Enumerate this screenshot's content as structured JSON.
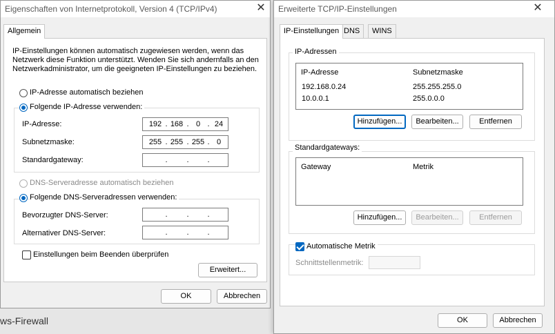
{
  "dialog1": {
    "title": "Eigenschaften von Internetprotokoll, Version 4 (TCP/IPv4)",
    "tab": "Allgemein",
    "intro_line1": "IP-Einstellungen können automatisch zugewiesen werden, wenn das",
    "intro_line2": "Netzwerk diese Funktion unterstützt. Wenden Sie sich andernfalls an den",
    "intro_line3": "Netzwerkadministrator, um die geeigneten IP-Einstellungen zu beziehen.",
    "radio_auto_ip": "IP-Adresse automatisch beziehen",
    "radio_manual_ip": "Folgende IP-Adresse verwenden:",
    "label_ip": "IP-Adresse:",
    "label_mask": "Subnetzmaske:",
    "label_gateway": "Standardgateway:",
    "ip_octets": [
      "192",
      "168",
      "0",
      "24"
    ],
    "mask_octets": [
      "255",
      "255",
      "255",
      "0"
    ],
    "radio_auto_dns": "DNS-Serveradresse automatisch beziehen",
    "radio_manual_dns": "Folgende DNS-Serveradressen verwenden:",
    "label_dns1": "Bevorzugter DNS-Server:",
    "label_dns2": "Alternativer DNS-Server:",
    "checkbox_validate": "Einstellungen beim Beenden überprüfen",
    "btn_advanced": "Erweitert...",
    "btn_ok": "OK",
    "btn_cancel": "Abbrechen"
  },
  "background_text": "ws-Firewall",
  "dialog2": {
    "title": "Erweiterte TCP/IP-Einstellungen",
    "tabs": [
      "IP-Einstellungen",
      "DNS",
      "WINS"
    ],
    "group_ip": "IP-Adressen",
    "col_ip": "IP-Adresse",
    "col_mask": "Subnetzmaske",
    "ip_rows": [
      {
        "ip": "192.168.0.24",
        "mask": "255.255.255.0"
      },
      {
        "ip": "10.0.0.1",
        "mask": "255.0.0.0"
      }
    ],
    "btn_add": "Hinzufügen...",
    "btn_edit": "Bearbeiten...",
    "btn_remove": "Entfernen",
    "group_gateways": "Standardgateways:",
    "col_gateway": "Gateway",
    "col_metric": "Metrik",
    "checkbox_auto_metric": "Automatische Metrik",
    "label_interface_metric": "Schnittstellenmetrik:",
    "btn_ok": "OK",
    "btn_cancel": "Abbrechen"
  },
  "colors": {
    "accent": "#0067c0",
    "window_bg": "#f0f0f0",
    "panel_bg": "#ffffff"
  }
}
